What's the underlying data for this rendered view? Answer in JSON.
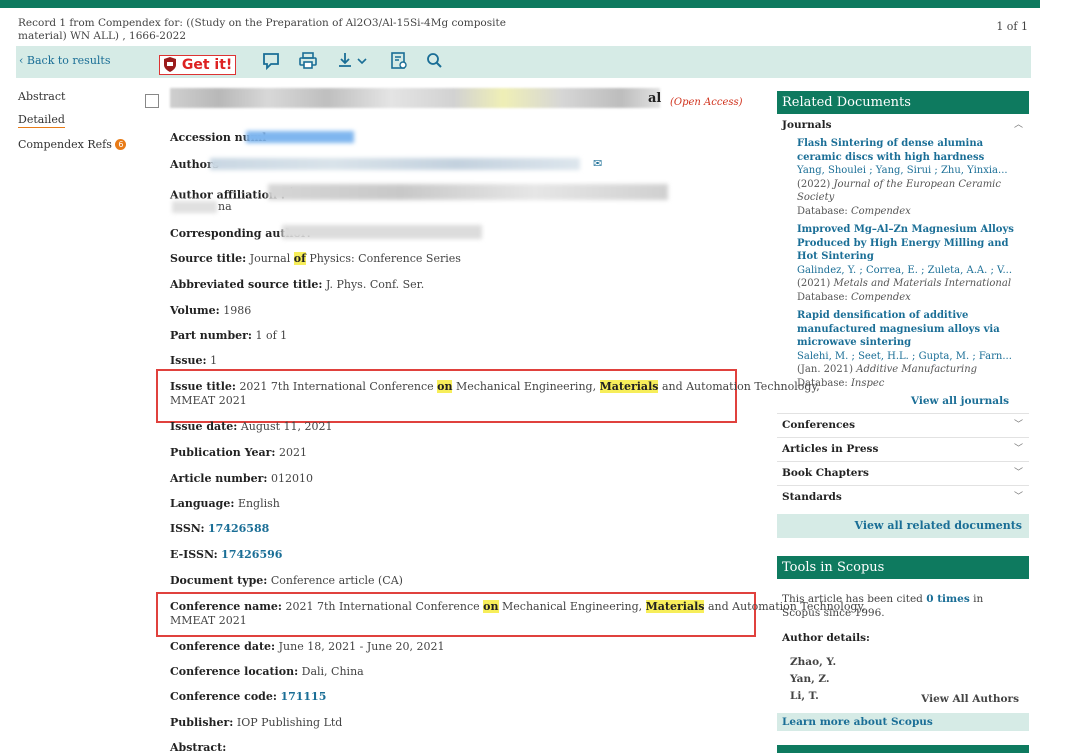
{
  "header": {
    "record": "Record 1 from Compendex for: ((Study on the Preparation of Al2O3/Al-15Si-4Mg composite material) WN ALL) , 1666-2022",
    "pager": "1 of 1"
  },
  "toolbar": {
    "back_label": "Back to results",
    "getit_label": "Get it!"
  },
  "left_nav": {
    "abstract": "Abstract",
    "detailed": "Detailed",
    "refs": "Compendex Refs",
    "refs_count": "6"
  },
  "record": {
    "title_tail": "al",
    "open_access": "(Open Access)",
    "accession_label": "Accession numl",
    "authors_label": "Authors",
    "affiliation_label": "Author affiliation : ",
    "affiliation_sup": "1",
    "affiliation_tail": "na",
    "corresponding_label": "Corresponding author:",
    "source_title_label": "Source title:",
    "source_title_a": "Journal",
    "source_title_hl": "of",
    "source_title_b": "Physics: Conference Series",
    "abbrev_label": "Abbreviated source title:",
    "abbrev_value": "J. Phys. Conf. Ser.",
    "volume_label": "Volume:",
    "volume_value": "1986",
    "part_label": "Part number:",
    "part_value": "1 of 1",
    "issue_label": "Issue:",
    "issue_value": "1",
    "issue_title_label": "Issue title:",
    "issue_title_a": "2021 7th International Conference",
    "issue_title_hl1": "on",
    "issue_title_b": "Mechanical Engineering,",
    "issue_title_hl2": "Materials",
    "issue_title_c": "and Automation Technology,",
    "issue_title_d": "MMEAT 2021",
    "issue_date_label": "Issue date:",
    "issue_date_value": "August 11, 2021",
    "pub_year_label": "Publication Year:",
    "pub_year_value": "2021",
    "article_label": "Article number:",
    "article_value": "012010",
    "language_label": "Language:",
    "language_value": "English",
    "issn_label": "ISSN:",
    "issn_value": "17426588",
    "eissn_label": "E-ISSN:",
    "eissn_value": "17426596",
    "doctype_label": "Document type:",
    "doctype_value": "Conference article (CA)",
    "conf_name_label": "Conference name:",
    "conf_name_a": "2021 7th International Conference",
    "conf_name_hl1": "on",
    "conf_name_b": "Mechanical Engineering,",
    "conf_name_hl2": "Materials",
    "conf_name_c": "and Automation Technology,",
    "conf_name_d": "MMEAT 2021",
    "conf_date_label": "Conference date:",
    "conf_date_value": "June 18, 2021 - June 20, 2021",
    "conf_loc_label": "Conference location:",
    "conf_loc_value": "Dali, China",
    "conf_code_label": "Conference code:",
    "conf_code_value": "171115",
    "publisher_label": "Publisher:",
    "publisher_value": "IOP Publishing Ltd",
    "abstract_label": "Abstract:"
  },
  "related": {
    "title": "Related Documents",
    "journals_label": "Journals",
    "docs": [
      {
        "title": "Flash Sintering of dense alumina ceramic discs with high hardness",
        "authors": "Yang, Shoulei ; Yang, Sirui ; Zhu, Yinxia...",
        "year": "(2022)",
        "journal": "Journal of the European Ceramic Society",
        "db_label": "Database:",
        "db": "Compendex"
      },
      {
        "title": "Improved Mg–Al–Zn Magnesium Alloys Produced by High Energy Milling and Hot Sintering",
        "authors": "Galindez, Y. ; Correa, E. ; Zuleta, A.A. ; V...",
        "year": "(2021)",
        "journal": "Metals and Materials International",
        "db_label": "Database:",
        "db": "Compendex"
      },
      {
        "title": "Rapid densification of additive manufactured magnesium alloys via microwave sintering",
        "authors": "Salehi, M. ; Seet, H.L. ; Gupta, M. ; Farn...",
        "year": "(Jan. 2021)",
        "journal": "Additive Manufacturing",
        "db_label": "Database:",
        "db": "Inspec"
      }
    ],
    "view_all_journals": "View all journals",
    "sections": [
      "Conferences",
      "Articles in Press",
      "Book Chapters",
      "Standards"
    ],
    "view_all_related": "View all related documents"
  },
  "tools": {
    "title": "Tools in Scopus",
    "cited_a": "This article has been cited",
    "cited_times": "0 times",
    "cited_b": "in Scopus since 1996.",
    "author_details": "Author details:",
    "authors": [
      "Zhao, Y.",
      "Yan, Z.",
      "Li, T."
    ],
    "view_all_authors": "View All Authors",
    "learn_more": "Learn more about Scopus"
  },
  "colors": {
    "brand": "#0e7a5f",
    "link": "#1a6e96",
    "highlight": "#f7ee5a",
    "annotation": "#e0413d"
  }
}
